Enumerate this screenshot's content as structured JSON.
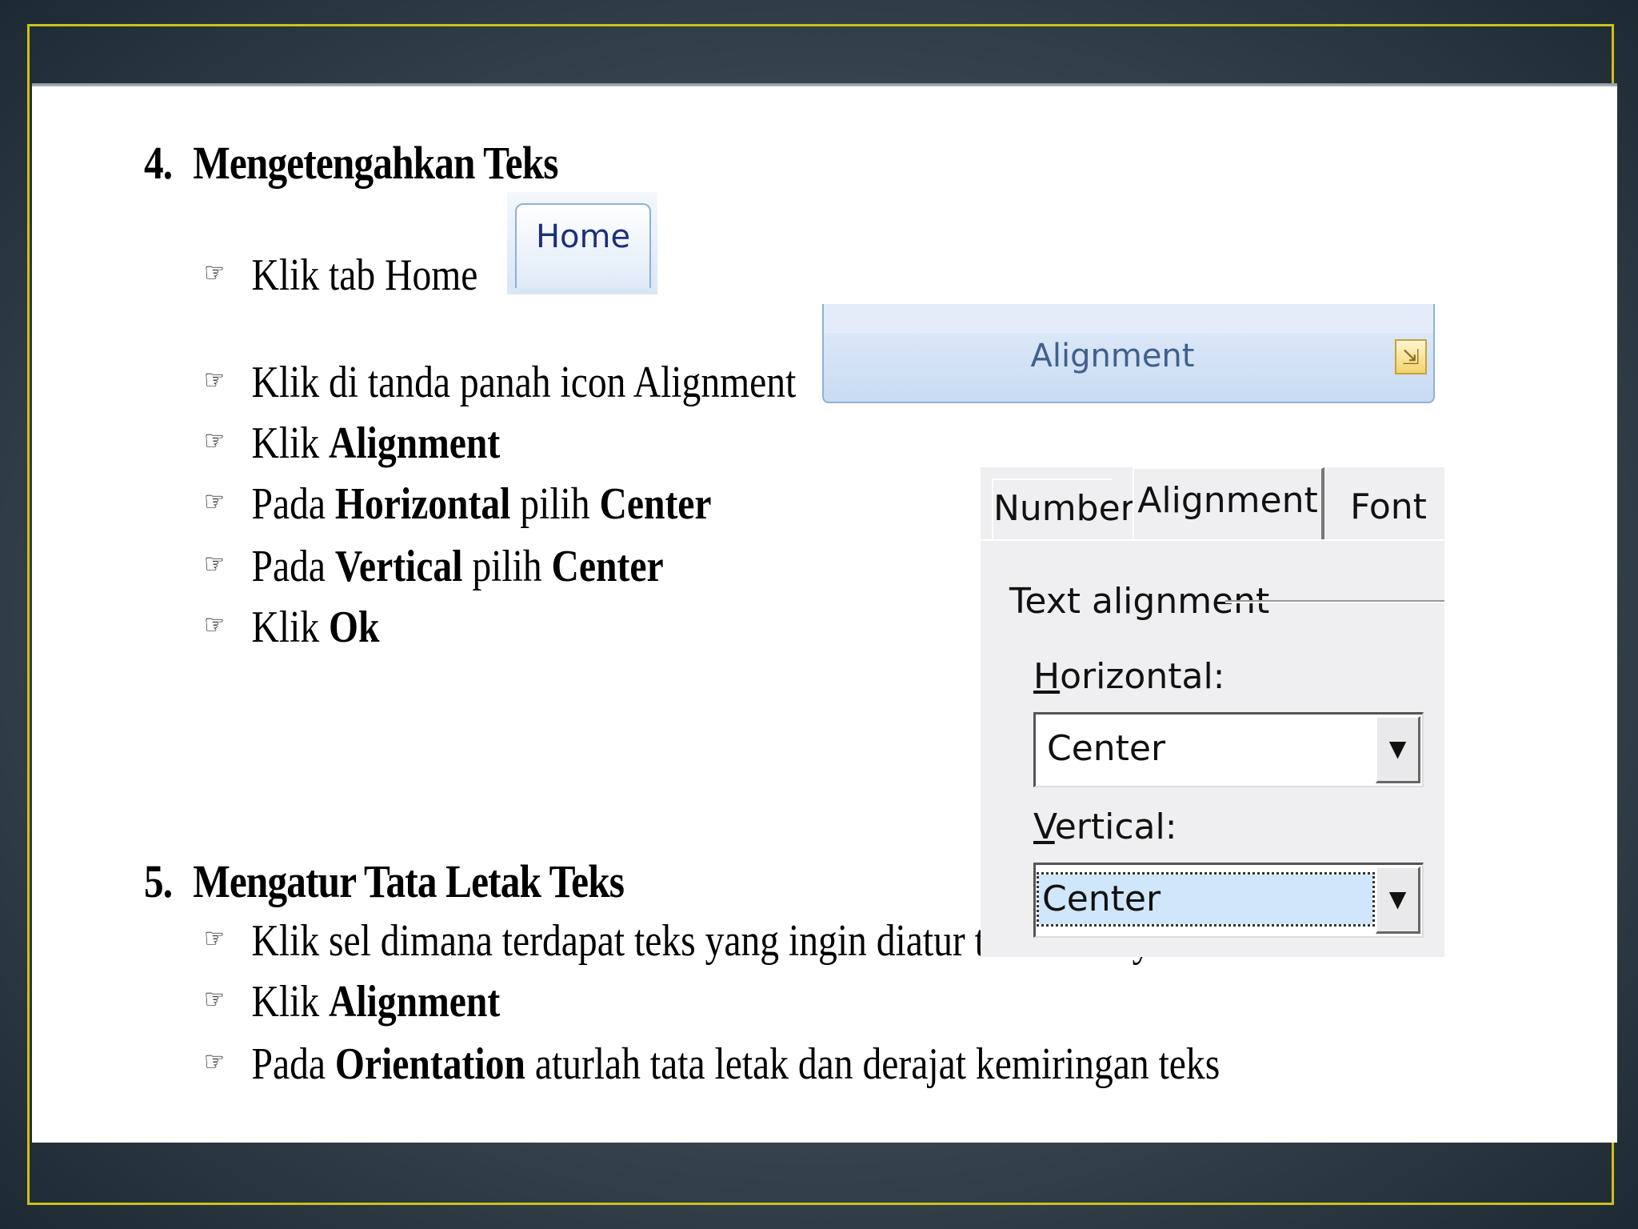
{
  "section4": {
    "number": "4.",
    "title": "Mengetengahkan Teks",
    "steps": [
      {
        "pre": "Klik tab Home",
        "bold": "",
        "mid": "",
        "bold2": "",
        "post": ""
      },
      {
        "pre": "Klik di tanda panah icon Alignment",
        "bold": "",
        "mid": "",
        "bold2": "",
        "post": ""
      },
      {
        "pre": "Klik ",
        "bold": "Alignment",
        "mid": "",
        "bold2": "",
        "post": ""
      },
      {
        "pre": "Pada ",
        "bold": "Horizontal",
        "mid": " pilih ",
        "bold2": "Center",
        "post": ""
      },
      {
        "pre": "Pada ",
        "bold": "Vertical",
        "mid": " pilih ",
        "bold2": "Center",
        "post": ""
      },
      {
        "pre": "Klik ",
        "bold": "Ok",
        "mid": "",
        "bold2": "",
        "post": ""
      }
    ]
  },
  "section5": {
    "number": "5.",
    "title": "Mengatur Tata Letak Teks",
    "steps": [
      {
        "pre": "Klik sel dimana terdapat teks yang ingin diatur tata letaknya",
        "bold": "",
        "mid": "",
        "bold2": "",
        "post": ""
      },
      {
        "pre": "Klik ",
        "bold": "Alignment",
        "mid": "",
        "bold2": "",
        "post": ""
      },
      {
        "pre": "Pada ",
        "bold": "Orientation",
        "mid": " aturlah tata letak dan derajat kemiringan teks",
        "bold2": "",
        "post": ""
      }
    ]
  },
  "bullet_glyph": "☞",
  "ribbon": {
    "home_tab_label": "Home",
    "alignment_group_label": "Alignment",
    "launcher_glyph": "⇲"
  },
  "dialog": {
    "tabs": [
      "Number",
      "Alignment",
      "Font"
    ],
    "section_label": "Text alignment",
    "horizontal_label_u": "H",
    "horizontal_label_rest": "orizontal:",
    "horizontal_value": "Center",
    "vertical_label_u": "V",
    "vertical_label_rest": "ertical:",
    "vertical_value": "Center",
    "dropdown_glyph": "▼"
  },
  "colors": {
    "frame_border": "#c9c21c",
    "ribbon_text": "#40608c",
    "home_tab_text": "#1d2f7a",
    "focus_fill": "#cfe6fb"
  }
}
